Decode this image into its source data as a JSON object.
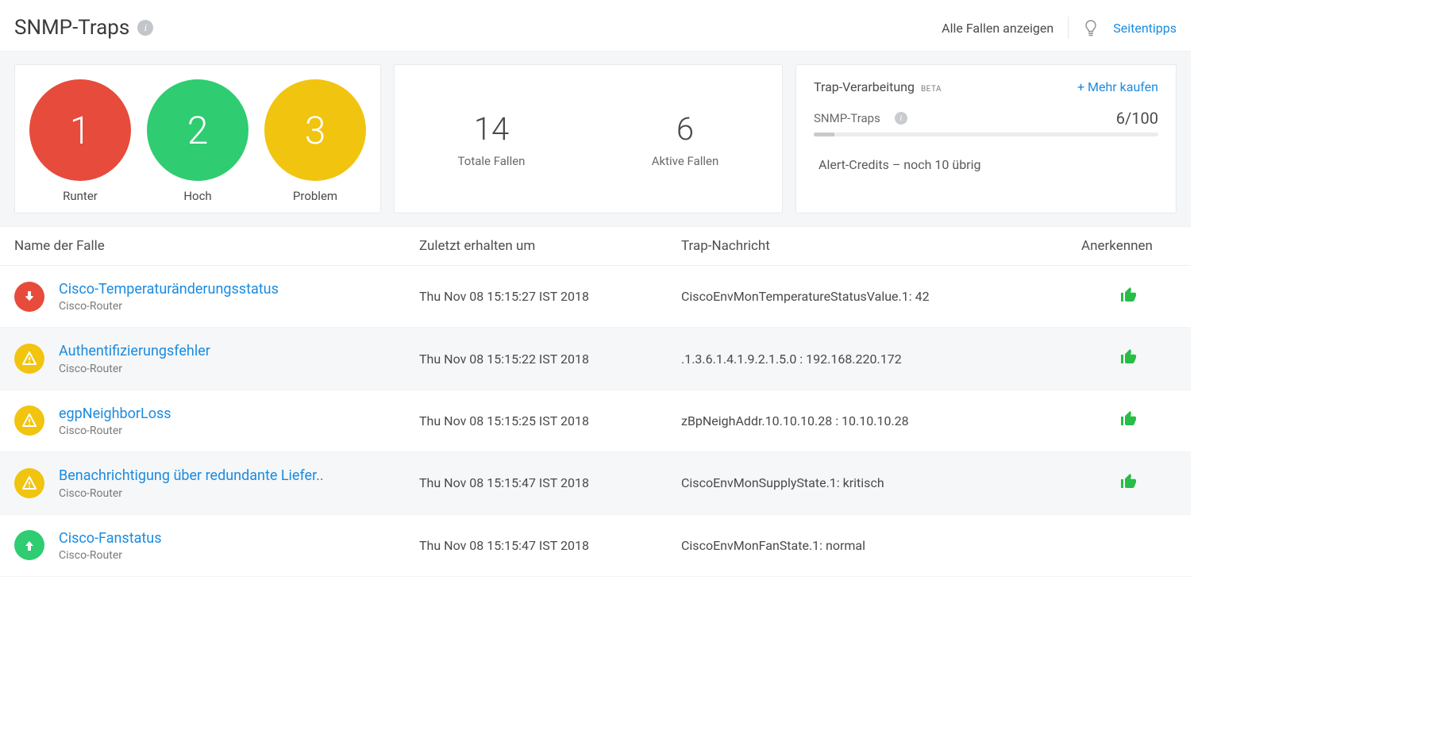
{
  "header": {
    "title": "SNMP-Traps",
    "show_all": "Alle Fallen anzeigen",
    "tips": "Seitentipps"
  },
  "status_circles": [
    {
      "count": "1",
      "label": "Runter",
      "color": "red"
    },
    {
      "count": "2",
      "label": "Hoch",
      "color": "green"
    },
    {
      "count": "3",
      "label": "Problem",
      "color": "yellow"
    }
  ],
  "totals": {
    "total_num": "14",
    "total_label": "Totale Fallen",
    "active_num": "6",
    "active_label": "Aktive Fallen"
  },
  "processing": {
    "title": "Trap-Verarbeitung",
    "beta": "BETA",
    "buy_more": "+ Mehr kaufen",
    "name": "SNMP-Traps",
    "usage": "6/100",
    "usage_pct": 6,
    "credits": "Alert-Credits – noch 10 übrig"
  },
  "columns": {
    "name": "Name der Falle",
    "time": "Zuletzt erhalten um",
    "msg": "Trap-Nachricht",
    "ack": "Anerkennen"
  },
  "rows": [
    {
      "status": "down",
      "title": "Cisco-Temperaturänderungsstatus",
      "sub": "Cisco-Router",
      "time": "Thu Nov 08 15:15:27 IST 2018",
      "msg": "CiscoEnvMonTemperatureStatusValue.1: 42",
      "ack": true
    },
    {
      "status": "warn",
      "title": "Authentifizierungsfehler",
      "sub": "Cisco-Router",
      "time": "Thu Nov 08 15:15:22 IST 2018",
      "msg": ".1.3.6.1.4.1.9.2.1.5.0 : 192.168.220.172",
      "ack": true
    },
    {
      "status": "warn",
      "title": "egpNeighborLoss",
      "sub": "Cisco-Router",
      "time": "Thu Nov 08 15:15:25 IST 2018",
      "msg": "zBpNeighAddr.10.10.10.28 : 10.10.10.28",
      "ack": true
    },
    {
      "status": "warn",
      "title": "Benachrichtigung über redundante Liefer..",
      "sub": "Cisco-Router",
      "time": "Thu Nov 08 15:15:47 IST 2018",
      "msg": "CiscoEnvMonSupplyState.1: kritisch",
      "ack": true
    },
    {
      "status": "up",
      "title": "Cisco-Fanstatus",
      "sub": "Cisco-Router",
      "time": "Thu Nov 08 15:15:47 IST 2018",
      "msg": "CiscoEnvMonFanState.1: normal",
      "ack": false
    }
  ]
}
